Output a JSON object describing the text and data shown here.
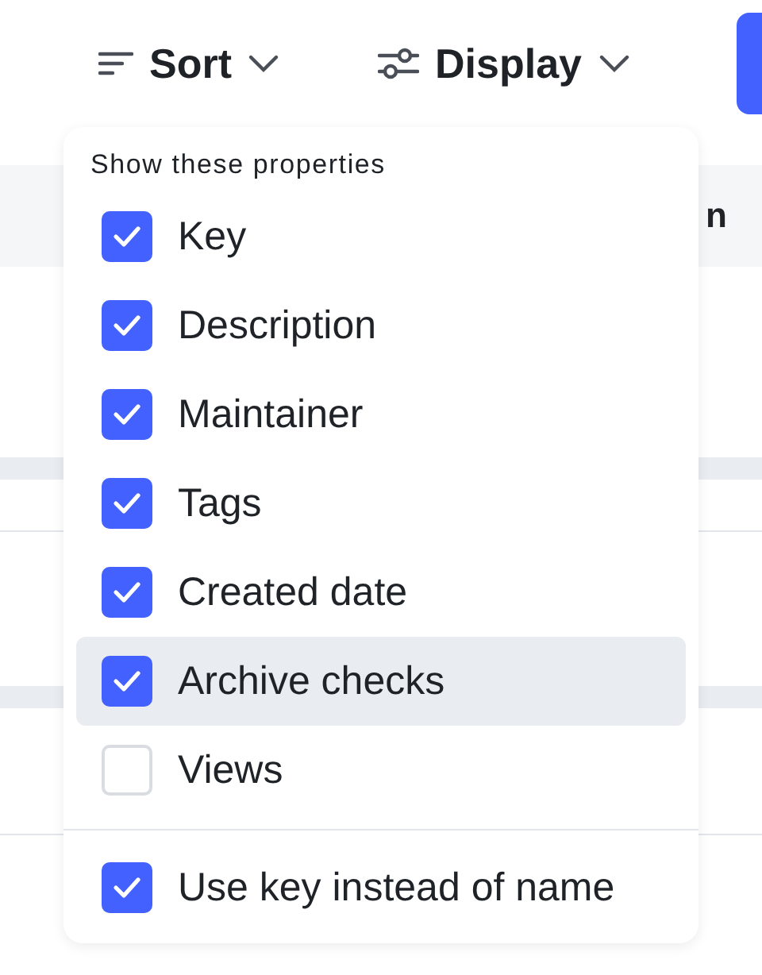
{
  "toolbar": {
    "sort_label": "Sort",
    "display_label": "Display"
  },
  "table": {
    "column_header": "n"
  },
  "menu": {
    "heading": "Show these properties",
    "items": [
      {
        "label": "Key",
        "checked": true,
        "selected": false
      },
      {
        "label": "Description",
        "checked": true,
        "selected": false
      },
      {
        "label": "Maintainer",
        "checked": true,
        "selected": false
      },
      {
        "label": "Tags",
        "checked": true,
        "selected": false
      },
      {
        "label": "Created date",
        "checked": true,
        "selected": false
      },
      {
        "label": "Archive checks",
        "checked": true,
        "selected": true
      },
      {
        "label": "Views",
        "checked": false,
        "selected": false
      }
    ],
    "footer_items": [
      {
        "label": "Use key instead of name",
        "checked": true,
        "selected": false
      }
    ]
  }
}
